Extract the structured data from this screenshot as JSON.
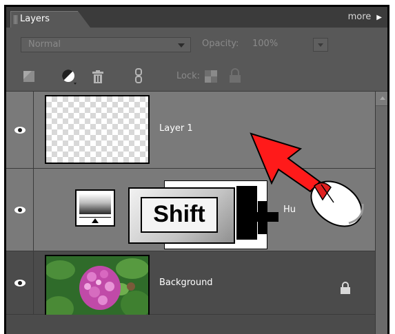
{
  "panel": {
    "tab_label": "Layers",
    "more_label": "more"
  },
  "options": {
    "blend_mode": "Normal",
    "opacity_label": "Opacity:",
    "opacity_value": "100%"
  },
  "toolbar": {
    "lock_label": "Lock:",
    "icons": [
      "new-layer-icon",
      "adjustment-layer-icon",
      "trash-icon",
      "link-icon",
      "lock-transparency-icon",
      "lock-all-icon"
    ]
  },
  "layers": [
    {
      "name": "Layer 1",
      "visible": true
    },
    {
      "name": "Hu",
      "visible": true
    },
    {
      "name": "Background",
      "visible": true,
      "locked": true
    }
  ],
  "overlay": {
    "key_label": "Shift"
  },
  "colors": {
    "panel_bg": "#4b4b4b",
    "selected_row": "#7a7a7a",
    "arrow_red": "#ff1a1a"
  }
}
